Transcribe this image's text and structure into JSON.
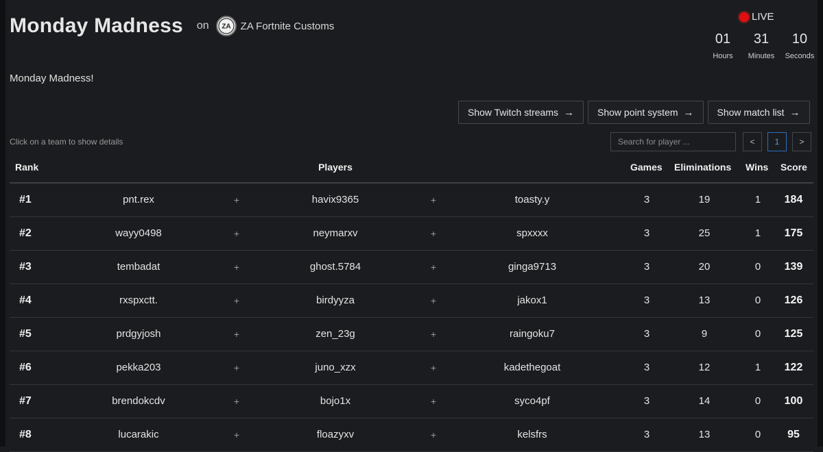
{
  "header": {
    "title": "Monday Madness",
    "on_label": "on",
    "org_logo_text": "ZA",
    "org_name": "ZA Fortnite Customs"
  },
  "live": {
    "label": "LIVE",
    "countdown": [
      {
        "value": "01",
        "label": "Hours"
      },
      {
        "value": "31",
        "label": "Minutes"
      },
      {
        "value": "10",
        "label": "Seconds"
      }
    ]
  },
  "description": "Monday Madness!",
  "buttons": {
    "twitch": "Show Twitch streams",
    "points": "Show point system",
    "matches": "Show match list"
  },
  "hint": "Click on a team to show details",
  "search": {
    "placeholder": "Search for player ..."
  },
  "pager": {
    "prev": "<",
    "page": "1",
    "next": ">"
  },
  "table": {
    "headers": {
      "rank": "Rank",
      "players": "Players",
      "games": "Games",
      "eliminations": "Eliminations",
      "wins": "Wins",
      "score": "Score"
    },
    "separator": "+",
    "rows": [
      {
        "rank": "#1",
        "p1": "pnt.rex",
        "p2": "havix9365",
        "p3": "toasty.y",
        "games": "3",
        "elims": "19",
        "wins": "1",
        "score": "184"
      },
      {
        "rank": "#2",
        "p1": "wayy0498",
        "p2": "neymarxv",
        "p3": "spxxxx",
        "games": "3",
        "elims": "25",
        "wins": "1",
        "score": "175"
      },
      {
        "rank": "#3",
        "p1": "tembadat",
        "p2": "ghost.5784",
        "p3": "ginga9713",
        "games": "3",
        "elims": "20",
        "wins": "0",
        "score": "139"
      },
      {
        "rank": "#4",
        "p1": "rxspxctt.",
        "p2": "birdyyza",
        "p3": "jakox1",
        "games": "3",
        "elims": "13",
        "wins": "0",
        "score": "126"
      },
      {
        "rank": "#5",
        "p1": "prdgyjosh",
        "p2": "zen_23g",
        "p3": "raingoku7",
        "games": "3",
        "elims": "9",
        "wins": "0",
        "score": "125"
      },
      {
        "rank": "#6",
        "p1": "pekka203",
        "p2": "juno_xzx",
        "p3": "kadethegoat",
        "games": "3",
        "elims": "12",
        "wins": "1",
        "score": "122"
      },
      {
        "rank": "#7",
        "p1": "brendokcdv",
        "p2": "bojo1x",
        "p3": "syco4pf",
        "games": "3",
        "elims": "14",
        "wins": "0",
        "score": "100"
      },
      {
        "rank": "#8",
        "p1": "lucarakic",
        "p2": "floazyxv",
        "p3": "kelsfrs",
        "games": "3",
        "elims": "13",
        "wins": "0",
        "score": "95"
      }
    ]
  },
  "colors": {
    "background": "#1b1c1f",
    "live_dot": "#e10e0e",
    "active_page": "#2e6fbf"
  }
}
